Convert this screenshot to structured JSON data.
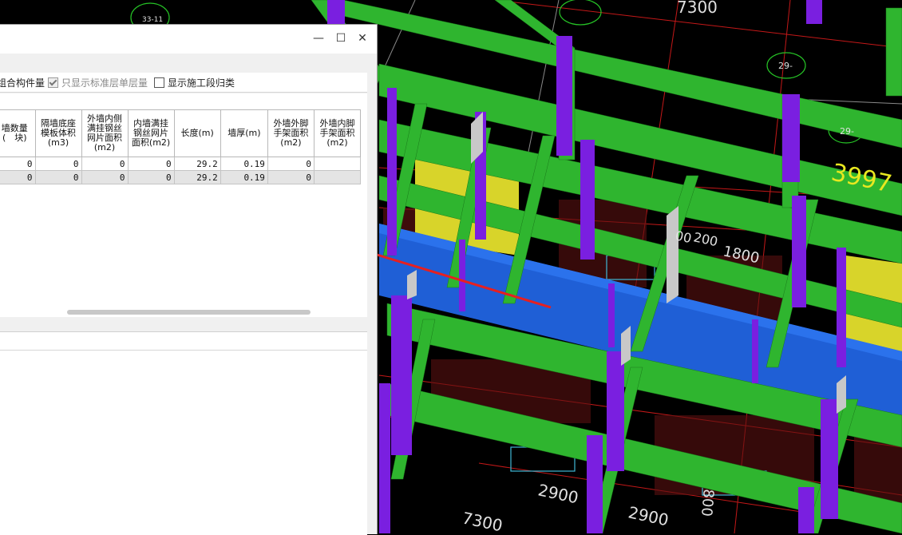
{
  "dialog": {
    "controls": {
      "minimize": "—",
      "maximize": "☐",
      "close": "✕"
    },
    "options": [
      {
        "label": "组合构件量",
        "checked": null
      },
      {
        "label": "只显示标准层单层量",
        "checked": true,
        "disabled": true
      },
      {
        "label": "显示施工段归类",
        "checked": false
      }
    ],
    "table": {
      "columns": [
        "墙数量( 块)",
        "隔墙底座模板体积(m3)",
        "外墙内侧满挂钢丝网片面积(m2)",
        "内墙满挂钢丝网片面积(m2)",
        "长度(m)",
        "墙厚(m)",
        "外墙外脚手架面积(m2)",
        "外墙内脚手架面积(m2)"
      ],
      "rows": [
        [
          "0",
          "0",
          "0",
          "0",
          "29.2",
          "0.19",
          "0",
          ""
        ],
        [
          "0",
          "0",
          "0",
          "0",
          "29.2",
          "0.19",
          "0",
          ""
        ]
      ],
      "selected_row": 1
    }
  },
  "cad": {
    "dims": [
      "7300",
      "3997",
      "1800",
      "200",
      "7300",
      "2900",
      "2900",
      "00",
      "800"
    ],
    "tags": [
      "29-",
      "29-",
      "33-11"
    ],
    "colors": {
      "beam": "#2fb52f",
      "column": "#7a1fe0",
      "blue_wall": "#1f5fd6",
      "yellow_wall": "#d8d42a",
      "arrow": "#e62020"
    }
  }
}
